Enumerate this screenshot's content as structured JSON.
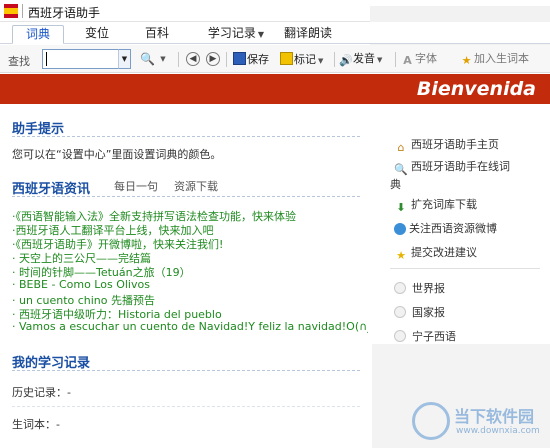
{
  "window": {
    "title": "西班牙语助手"
  },
  "tabs": [
    {
      "label": "词典",
      "active": true
    },
    {
      "label": "变位"
    },
    {
      "label": "百科"
    },
    {
      "label": "学习记录",
      "has_dropdown": true
    },
    {
      "label": "翻译朗读"
    }
  ],
  "toolbar": {
    "search_label": "查找",
    "search_value": "",
    "save_label": "保存",
    "mark_label": "标记",
    "speak_label": "发音",
    "font_label": "字体",
    "add_word_label": "加入生词本"
  },
  "banner": {
    "text": "Bienvenida",
    "color": "#c22b0c"
  },
  "main": {
    "tip": {
      "title": "助手提示",
      "text": "您可以在“设置中心”里面设置词典的颜色。"
    },
    "news": {
      "title": "西班牙语资讯",
      "subtabs": [
        "每日一句",
        "资源下载"
      ],
      "items": [
        "·《西语智能输入法》全新支持拼写语法检查功能，快来体验",
        "·西班牙语人工翻译平台上线，快来加入吧",
        "·《西班牙语助手》开微博啦，快来关注我们!",
        "· 天空上的三公尺——完结篇",
        "· 时间的针脚——Tetuán之旅（19）",
        "· BEBE - Como Los Olivos",
        "· un cuento chino 先播预告",
        "· 西班牙语中级听力：Historia del pueblo",
        "· Vamos a escuchar un cuento de Navidad!Y feliz la navidad!O(∩_∩)O~"
      ]
    },
    "records": {
      "title": "我的学习记录",
      "history_label": "历史记录：-",
      "wordbook_label": "生词本：-"
    }
  },
  "sidebar": {
    "links": [
      {
        "label": "西班牙语助手主页",
        "icon": "home-icon"
      },
      {
        "label": "西班牙语助手在线词",
        "continuation": "典",
        "icon": "search-icon"
      },
      {
        "label": "扩充词库下载",
        "icon": "download-icon"
      },
      {
        "label": "关注西语资源微博",
        "icon": "globe-icon"
      },
      {
        "label": "提交改进建议",
        "icon": "star-icon"
      }
    ],
    "radios": [
      "世界报",
      "国家报",
      "宁子西语"
    ]
  },
  "watermark": {
    "text": "当下软件园",
    "url": "www.downxia.com"
  }
}
